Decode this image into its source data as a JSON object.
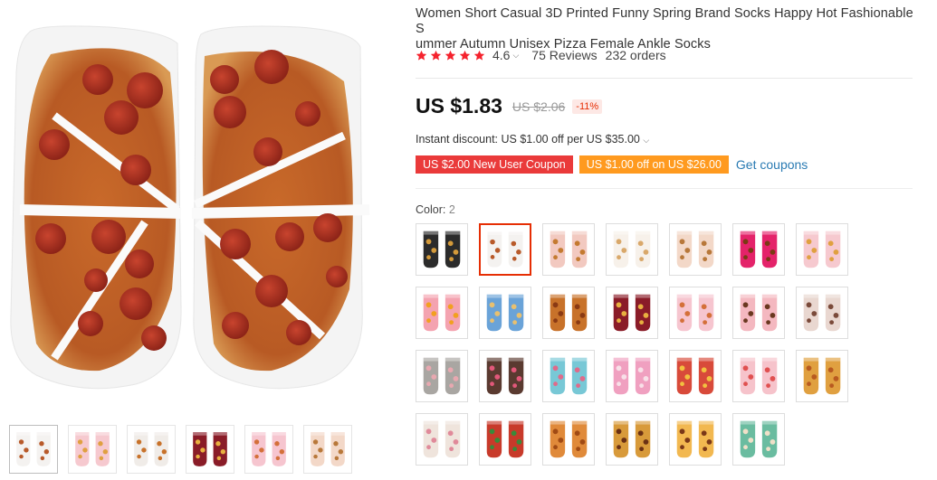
{
  "product": {
    "title": "Women Short Casual 3D Printed Funny Spring Brand Socks Happy Hot Fashionable S\nummer Autumn Unisex Pizza Female Ankle Socks",
    "rating": "4.6",
    "reviews": "75 Reviews",
    "orders": "232 orders"
  },
  "pricing": {
    "price": "US $1.83",
    "old_price": "US $2.06",
    "discount": "-11%",
    "instant_discount": "Instant discount: US $1.00 off per US $35.00"
  },
  "coupons": {
    "new_user": "US $2.00 New User Coupon",
    "off": "US $1.00 off on US $26.00",
    "get": "Get coupons"
  },
  "color": {
    "label": "Color:",
    "count": "2"
  },
  "colors": {
    "star": "#f5222d",
    "accent": "#e62e04",
    "coupon_red": "#ea3a3a",
    "coupon_orange": "#ff9a1f",
    "link": "#2a7bb3"
  },
  "swatches": [
    {
      "row": 0,
      "col": 0,
      "bg": "#2b2b2b",
      "dot": "#d49a3a"
    },
    {
      "row": 0,
      "col": 1,
      "bg": "#f4f2f0",
      "dot": "#b85a2a",
      "selected": true
    },
    {
      "row": 0,
      "col": 2,
      "bg": "#f2c9c0",
      "dot": "#c47a30"
    },
    {
      "row": 0,
      "col": 3,
      "bg": "#f7f1ea",
      "dot": "#d9a86a"
    },
    {
      "row": 0,
      "col": 4,
      "bg": "#f3d8c8",
      "dot": "#b8783a"
    },
    {
      "row": 0,
      "col": 5,
      "bg": "#e4236a",
      "dot": "#7a3a14"
    },
    {
      "row": 0,
      "col": 6,
      "bg": "#f6c9cf",
      "dot": "#e0a040"
    },
    {
      "row": 1,
      "col": 0,
      "bg": "#f4a3b0",
      "dot": "#f2a020"
    },
    {
      "row": 1,
      "col": 1,
      "bg": "#6aa3d8",
      "dot": "#e8c070"
    },
    {
      "row": 1,
      "col": 2,
      "bg": "#c8722a",
      "dot": "#8a3a14"
    },
    {
      "row": 1,
      "col": 3,
      "bg": "#8a1c28",
      "dot": "#e8b040"
    },
    {
      "row": 1,
      "col": 4,
      "bg": "#f6c5cf",
      "dot": "#d4703a"
    },
    {
      "row": 1,
      "col": 5,
      "bg": "#f4b8c0",
      "dot": "#6a3820"
    },
    {
      "row": 1,
      "col": 6,
      "bg": "#e9d7d0",
      "dot": "#7a4a3a"
    },
    {
      "row": 2,
      "col": 0,
      "bg": "#a9a6a2",
      "dot": "#e8a8b0"
    },
    {
      "row": 2,
      "col": 1,
      "bg": "#5a3a30",
      "dot": "#e2587a"
    },
    {
      "row": 2,
      "col": 2,
      "bg": "#78c8d6",
      "dot": "#e06a8a"
    },
    {
      "row": 2,
      "col": 3,
      "bg": "#f0a0c0",
      "dot": "#f8e0e8"
    },
    {
      "row": 2,
      "col": 4,
      "bg": "#d84a3a",
      "dot": "#f2c040"
    },
    {
      "row": 2,
      "col": 5,
      "bg": "#f6c3cb",
      "dot": "#e05050"
    },
    {
      "row": 2,
      "col": 6,
      "bg": "#e0a040",
      "dot": "#b85a20"
    },
    {
      "row": 3,
      "col": 0,
      "bg": "#efe4dc",
      "dot": "#e08a9a"
    },
    {
      "row": 3,
      "col": 1,
      "bg": "#c83a2a",
      "dot": "#3a8a3a"
    },
    {
      "row": 3,
      "col": 2,
      "bg": "#e08a3a",
      "dot": "#a04a14"
    },
    {
      "row": 3,
      "col": 3,
      "bg": "#d89a3a",
      "dot": "#6a3014"
    },
    {
      "row": 3,
      "col": 4,
      "bg": "#f2b850",
      "dot": "#7a3818"
    },
    {
      "row": 3,
      "col": 5,
      "bg": "#6abca0",
      "dot": "#f0e0c8"
    }
  ],
  "thumbnails": [
    {
      "bg": "#f4f2f0",
      "dot": "#b85a2a"
    },
    {
      "bg": "#f6c9cf",
      "dot": "#e0a040"
    },
    {
      "bg": "#f0ece8",
      "dot": "#c8722a"
    },
    {
      "bg": "#8a1c28",
      "dot": "#e8b040"
    },
    {
      "bg": "#f6c5cf",
      "dot": "#d4703a"
    },
    {
      "bg": "#f3d8c8",
      "dot": "#b8783a"
    }
  ]
}
